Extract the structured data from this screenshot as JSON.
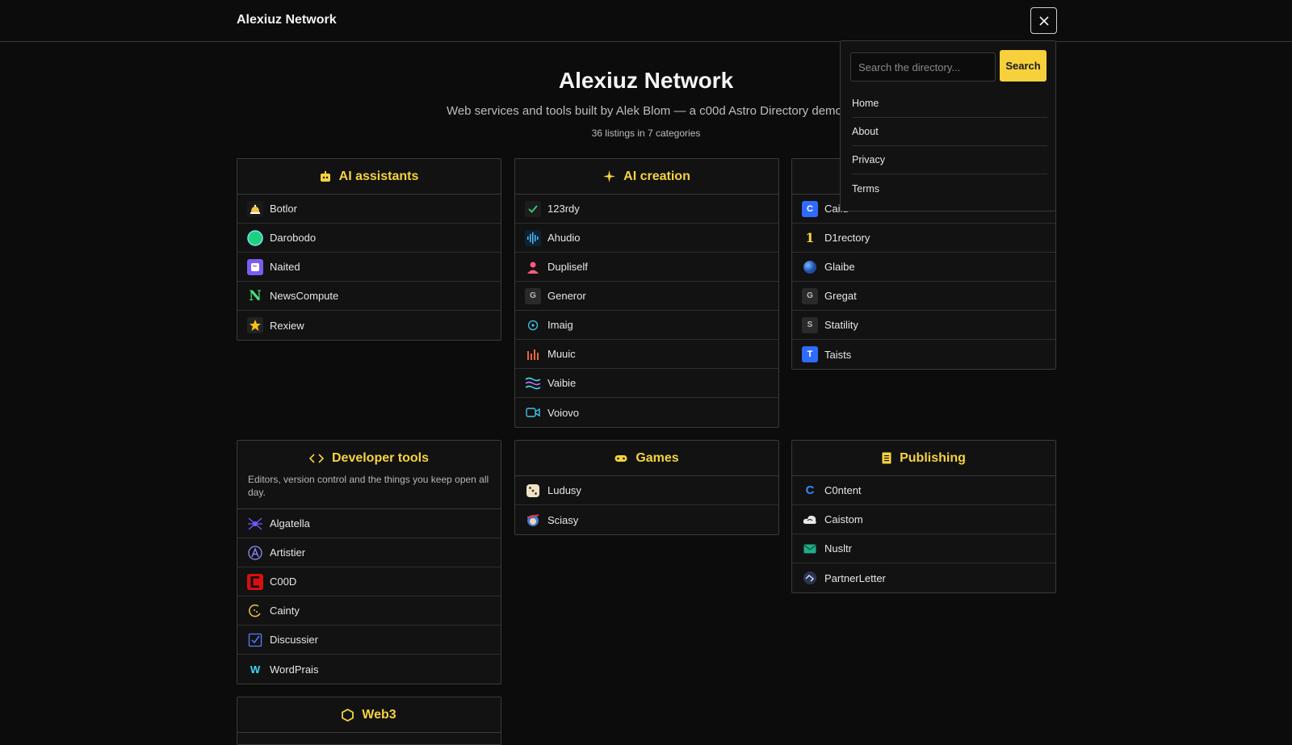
{
  "header": {
    "brand": "Alexiuz Network"
  },
  "hero": {
    "title": "Alexiuz Network",
    "subtitle": "Web services and tools built by Alek Blom — a c00d Astro Directory demo.",
    "count": "36 listings in 7 categories"
  },
  "categories": [
    {
      "title": "AI assistants",
      "icon": "robot-icon",
      "items": [
        "Botlor",
        "Darobodo",
        "Naited",
        "NewsCompute",
        "Rexiew"
      ]
    },
    {
      "title": "AI creation",
      "icon": "sparkle-icon",
      "items": [
        "123rdy",
        "Ahudio",
        "Dupliself",
        "Generor",
        "Imaig",
        "Muuic",
        "Vaibie",
        "Voiovo"
      ]
    },
    {
      "title": "",
      "icon": "",
      "items": [
        "Cailu",
        "D1rectory",
        "Glaibe",
        "Gregat",
        "Statility",
        "Taists"
      ]
    },
    {
      "title": "Developer tools",
      "icon": "code-icon",
      "description": "Editors, version control and the things you keep open all day.",
      "items": [
        "Algatella",
        "Artistier",
        "C00D",
        "Cainty",
        "Discussier",
        "WordPrais"
      ]
    },
    {
      "title": "Games",
      "icon": "gamepad-icon",
      "items": [
        "Ludusy",
        "Sciasy"
      ]
    },
    {
      "title": "Publishing",
      "icon": "document-icon",
      "items": [
        "C0ntent",
        "Caistom",
        "Nusltr",
        "PartnerLetter"
      ]
    },
    {
      "title": "Web3",
      "icon": "hexagon-icon",
      "items": []
    }
  ],
  "dropdown": {
    "search_placeholder": "Search the directory...",
    "search_button": "Search",
    "menu": [
      "Home",
      "About",
      "Privacy",
      "Terms"
    ]
  },
  "colors": {
    "accent": "#f5d33f",
    "background": "#0c0c0c",
    "card": "#121212",
    "border": "#3a3a3a"
  }
}
